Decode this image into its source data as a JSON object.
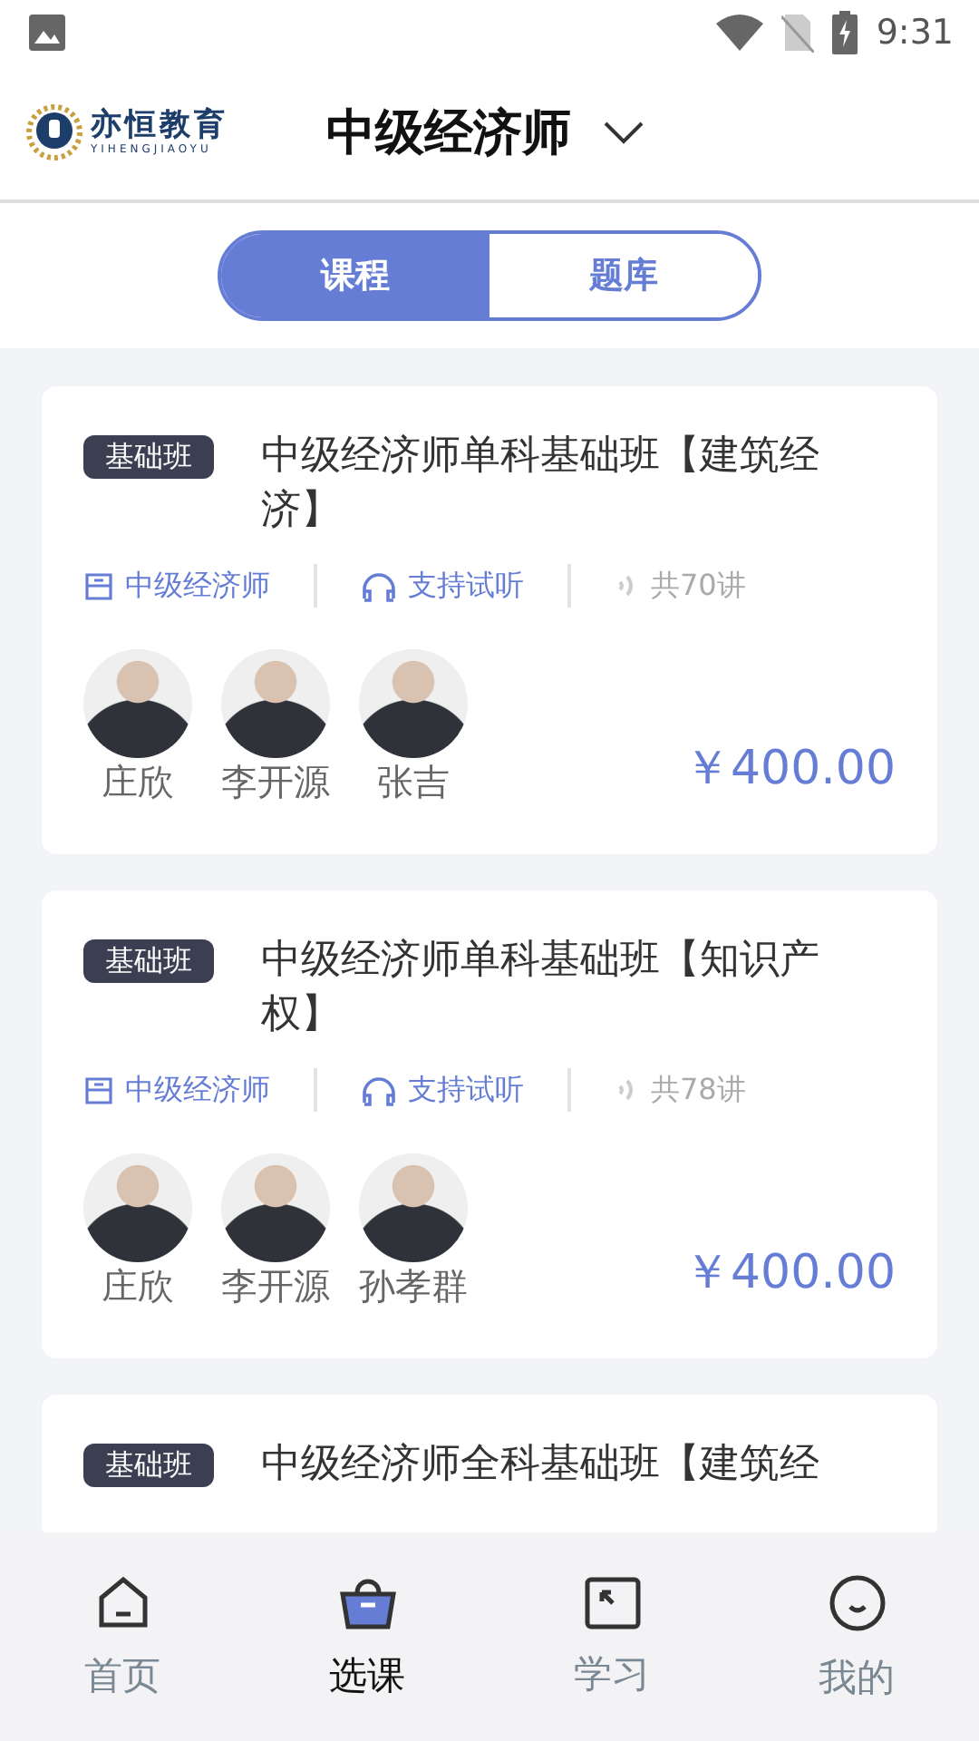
{
  "status_bar": {
    "time": "9:31"
  },
  "header": {
    "logo_text": "亦恒教育",
    "logo_subtext": "YIHENGJIAOYU",
    "title": "中级经济师"
  },
  "segments": [
    {
      "label": "课程",
      "selected": true
    },
    {
      "label": "题库",
      "selected": false
    }
  ],
  "courses": [
    {
      "tag": "基础班",
      "title": "中级经济师单科基础班【建筑经济】",
      "category": "中级经济师",
      "trial": "支持试听",
      "lessons": "共70讲",
      "teachers": [
        "庄欣",
        "李开源",
        "张吉"
      ],
      "price": "￥400.00"
    },
    {
      "tag": "基础班",
      "title": "中级经济师单科基础班【知识产权】",
      "category": "中级经济师",
      "trial": "支持试听",
      "lessons": "共78讲",
      "teachers": [
        "庄欣",
        "李开源",
        "孙孝群"
      ],
      "price": "￥400.00"
    },
    {
      "tag": "基础班",
      "title": "中级经济师全科基础班【建筑经"
    }
  ],
  "bottom_nav": [
    {
      "label": "首页",
      "selected": false
    },
    {
      "label": "选课",
      "selected": true
    },
    {
      "label": "学习",
      "selected": false
    },
    {
      "label": "我的",
      "selected": false
    }
  ]
}
